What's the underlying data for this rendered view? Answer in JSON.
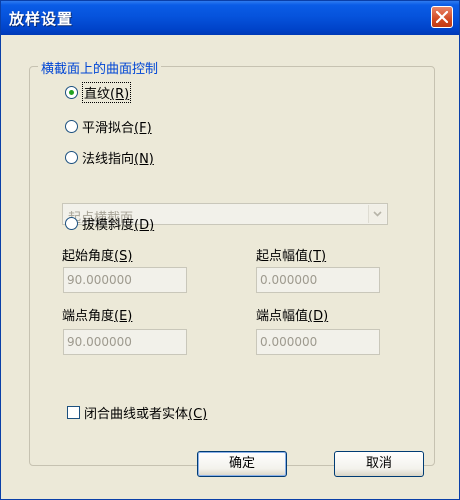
{
  "window": {
    "title": "放样设置"
  },
  "group": {
    "title": "横截面上的曲面控制"
  },
  "options": {
    "ruled": {
      "label": "直纹",
      "hotkey": "(R)",
      "checked": true
    },
    "smooth": {
      "label": "平滑拟合",
      "hotkey": "(F)",
      "checked": false
    },
    "normal": {
      "label": "法线指向",
      "hotkey": "(N)",
      "checked": false
    },
    "draft": {
      "label": "拔模斜度",
      "hotkey": "(D)",
      "checked": false
    }
  },
  "normal_select": {
    "value": "起点横截面"
  },
  "fields": {
    "start_angle": {
      "label": "起始角度",
      "hotkey": "(S)",
      "value": "90.000000"
    },
    "start_magnitude": {
      "label": "起点幅值",
      "hotkey": "(T)",
      "value": "0.000000"
    },
    "end_angle": {
      "label": "端点角度",
      "hotkey": "(E)",
      "value": "90.000000"
    },
    "end_magnitude": {
      "label": "端点幅值",
      "hotkey": "(D)",
      "value": "0.000000"
    }
  },
  "close_surface": {
    "label": "闭合曲线或者实体",
    "hotkey": "(C)",
    "checked": false
  },
  "buttons": {
    "ok": "确定",
    "cancel": "取消"
  }
}
